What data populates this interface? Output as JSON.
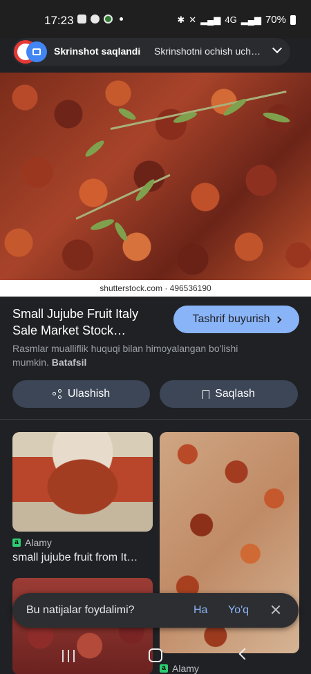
{
  "status_bar": {
    "time": "17:23",
    "battery": "70%",
    "network": "4G"
  },
  "notification": {
    "title": "Skrinshot saqlandi",
    "text": "Skrinshotni ochish uch…"
  },
  "hero": {
    "caption": "shutterstock.com · 496536190"
  },
  "result": {
    "title": "Small Jujube Fruit Italy Sale Market Stock…",
    "visit_label": "Tashrif buyurish",
    "copyright_text": "Rasmlar mualliflik huquqi bilan himoyalangan bo'lishi mumkin.",
    "learn_more": "Batafsil",
    "share_label": "Ulashish",
    "save_label": "Saqlash"
  },
  "grid": [
    {
      "source": "Alamy",
      "title": "small jujube fruit from It…"
    },
    {
      "source": "Alamy"
    }
  ],
  "feedback": {
    "question": "Bu natijalar foydalimi?",
    "yes": "Ha",
    "no": "Yo'q"
  }
}
